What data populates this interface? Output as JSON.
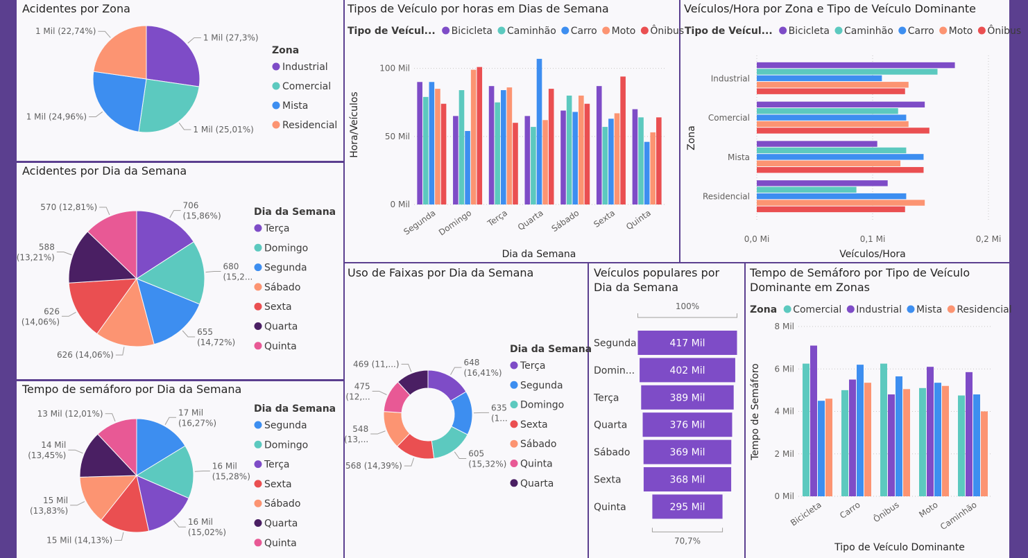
{
  "colors": {
    "Bicicleta": "#7e4cc7",
    "Caminhão": "#5cc9bf",
    "Carro": "#3d8ef0",
    "Moto": "#fc9472",
    "Ônibus": "#ea4f51",
    "Industrial": "#7e4cc7",
    "Comercial": "#5cc9bf",
    "Mista": "#3d8ef0",
    "Residencial": "#fc9472",
    "Terça": "#7e4cc7",
    "Domingo": "#5cc9bf",
    "Segunda": "#3d8ef0",
    "Sábado": "#fc9472",
    "Sexta": "#ea4f51",
    "Quarta": "#4a1f63",
    "Quinta": "#e85995"
  },
  "chart_data": [
    {
      "id": "acidentes_zona",
      "type": "pie",
      "title": "Acidentes por Zona",
      "legend_title": "Zona",
      "slices": [
        {
          "name": "Industrial",
          "label": "1 Mil (27,3%)",
          "value": 27.3
        },
        {
          "name": "Comercial",
          "label": "1 Mil (25,01%)",
          "value": 25.01
        },
        {
          "name": "Mista",
          "label": "1 Mil (24,96%)",
          "value": 24.96
        },
        {
          "name": "Residencial",
          "label": "1 Mil (22,74%)",
          "value": 22.74
        }
      ]
    },
    {
      "id": "acidentes_dia",
      "type": "pie",
      "title": "Acidentes por Dia da Semana",
      "legend_title": "Dia da Semana",
      "slices": [
        {
          "name": "Terça",
          "label": "706 (15,86%)",
          "value": 706
        },
        {
          "name": "Domingo",
          "label": "680 (15,2...",
          "value": 680
        },
        {
          "name": "Segunda",
          "label": "655 (14,72%)",
          "value": 655
        },
        {
          "name": "Sábado",
          "label": "626 (14,06%)",
          "value": 626
        },
        {
          "name": "Sexta",
          "label": "626 (14,06%)",
          "value": 626
        },
        {
          "name": "Quarta",
          "label": "588 (13,21%)",
          "value": 588
        },
        {
          "name": "Quinta",
          "label": "570 (12,81%)",
          "value": 570
        }
      ]
    },
    {
      "id": "semaforo_dia",
      "type": "pie",
      "title": "Tempo de semáforo por Dia da Semana",
      "legend_title": "Dia da Semana",
      "slices": [
        {
          "name": "Segunda",
          "label": "17 Mil (16,27%)",
          "value": 16.27
        },
        {
          "name": "Domingo",
          "label": "16 Mil (15,28%)",
          "value": 15.28
        },
        {
          "name": "Terça",
          "label": "16 Mil (15,02%)",
          "value": 15.02
        },
        {
          "name": "Sexta",
          "label": "15 Mil (14,13%)",
          "value": 14.13
        },
        {
          "name": "Sábado",
          "label": "15 Mil (13,83%)",
          "value": 13.83
        },
        {
          "name": "Quarta",
          "label": "14 Mil (13,45%)",
          "value": 13.45
        },
        {
          "name": "Quinta",
          "label": "13 Mil (12,01%)",
          "value": 12.01
        }
      ]
    },
    {
      "id": "veiculos_dia",
      "type": "bar",
      "title": "Tipos de Veículo por horas em Dias de Semana",
      "legend_title": "Tipo de Veícul...",
      "xlabel": "Dia da Semana",
      "ylabel": "Hora/Veículos",
      "yticks": [
        "0 Mil",
        "50 Mil",
        "100 Mil"
      ],
      "ylim": [
        0,
        110
      ],
      "categories": [
        "Segunda",
        "Domingo",
        "Terça",
        "Quarta",
        "Sábado",
        "Sexta",
        "Quinta"
      ],
      "series": [
        {
          "name": "Bicicleta",
          "values": [
            90,
            65,
            87,
            65,
            69,
            87,
            70
          ]
        },
        {
          "name": "Caminhão",
          "values": [
            79,
            84,
            75,
            57,
            80,
            57,
            64
          ]
        },
        {
          "name": "Carro",
          "values": [
            90,
            54,
            84,
            107,
            68,
            63,
            46
          ]
        },
        {
          "name": "Moto",
          "values": [
            85,
            99,
            86,
            62,
            80,
            67,
            53
          ]
        },
        {
          "name": "Ônibus",
          "values": [
            74,
            101,
            60,
            85,
            74,
            94,
            64
          ]
        }
      ]
    },
    {
      "id": "veiculos_zona",
      "type": "bar",
      "orientation": "horizontal",
      "title": "Veículos/Hora por Zona e Tipo de Veículo Dominante",
      "legend_title": "Tipo de Veícul...",
      "xlabel": "Veículos/Hora",
      "ylabel": "Zona",
      "xticks": [
        "0,0 Mi",
        "0,1 Mi",
        "0,2 Mi"
      ],
      "xlim": [
        0,
        0.2
      ],
      "categories": [
        "Industrial",
        "Comercial",
        "Mista",
        "Residencial"
      ],
      "series": [
        {
          "name": "Bicicleta",
          "values": [
            0.171,
            0.145,
            0.104,
            0.113
          ]
        },
        {
          "name": "Caminhão",
          "values": [
            0.156,
            0.122,
            0.129,
            0.086
          ]
        },
        {
          "name": "Carro",
          "values": [
            0.108,
            0.129,
            0.144,
            0.129
          ]
        },
        {
          "name": "Moto",
          "values": [
            0.131,
            0.131,
            0.124,
            0.145
          ]
        },
        {
          "name": "Ônibus",
          "values": [
            0.128,
            0.149,
            0.144,
            0.128
          ]
        }
      ]
    },
    {
      "id": "faixas_dia",
      "type": "donut",
      "title": "Uso de Faixas por Dia da Semana",
      "legend_title": "Dia da Semana",
      "slices": [
        {
          "name": "Terça",
          "label": "648 (16,41%)",
          "value": 648
        },
        {
          "name": "Segunda",
          "label": "635 (1...",
          "value": 635
        },
        {
          "name": "Domingo",
          "label": "605 (15,32%)",
          "value": 605
        },
        {
          "name": "Sexta",
          "label": "568 (14,39%)",
          "value": 568
        },
        {
          "name": "Sábado",
          "label": "548 (13,...",
          "value": 548
        },
        {
          "name": "Quinta",
          "label": "475 (12,...",
          "value": 475
        },
        {
          "name": "Quarta",
          "label": "469 (11,...)",
          "value": 469
        }
      ]
    },
    {
      "id": "funil",
      "type": "funnel",
      "title": "Veículos populares por Dia da Semana",
      "top_label": "100%",
      "bottom_label": "70,7%",
      "categories": [
        "Segunda",
        "Domin...",
        "Terça",
        "Quarta",
        "Sábado",
        "Sexta",
        "Quinta"
      ],
      "values": [
        417,
        402,
        389,
        376,
        369,
        368,
        295
      ],
      "value_labels": [
        "417 Mil",
        "402 Mil",
        "389 Mil",
        "376 Mil",
        "369 Mil",
        "368 Mil",
        "295 Mil"
      ]
    },
    {
      "id": "semaforo_tipo",
      "type": "bar",
      "title": "Tempo de Semáforo por Tipo de Veículo Dominante em Zonas",
      "legend_title": "Zona",
      "xlabel": "Tipo de Veículo Dominante",
      "ylabel": "Tempo de Semáforo",
      "yticks": [
        "0 Mil",
        "2 Mil",
        "4 Mil",
        "6 Mil",
        "8 Mil"
      ],
      "ylim": [
        0,
        8
      ],
      "categories": [
        "Bicicleta",
        "Carro",
        "Ônibus",
        "Moto",
        "Caminhão"
      ],
      "series": [
        {
          "name": "Comercial",
          "values": [
            6.25,
            5.0,
            6.25,
            5.1,
            4.75
          ]
        },
        {
          "name": "Industrial",
          "values": [
            7.1,
            5.5,
            4.8,
            6.1,
            5.85
          ]
        },
        {
          "name": "Mista",
          "values": [
            4.5,
            6.2,
            5.65,
            5.35,
            4.8
          ]
        },
        {
          "name": "Residencial",
          "values": [
            4.6,
            5.35,
            5.05,
            5.2,
            4.0
          ]
        }
      ]
    }
  ]
}
